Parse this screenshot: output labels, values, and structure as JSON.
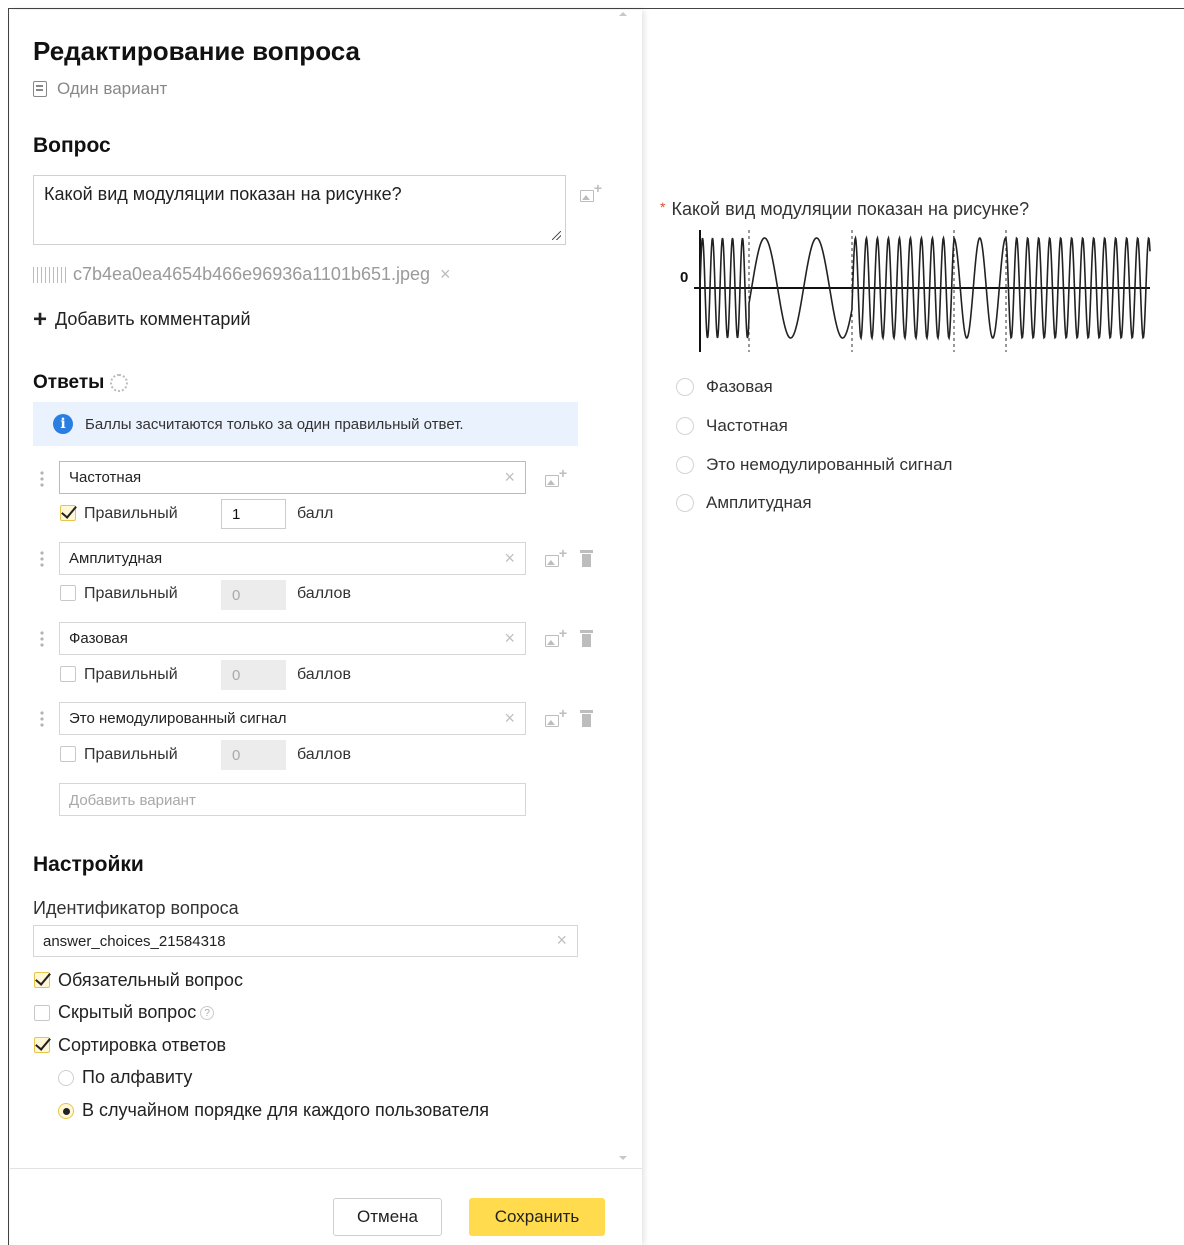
{
  "editor": {
    "title": "Редактирование вопроса",
    "question_type": "Один вариант",
    "question_section": "Вопрос",
    "question_text": "Какой вид модуляции показан на рисунке?",
    "attachment_filename": "c7b4ea0ea4654b466e96936a1101b651.jpeg",
    "add_comment_label": "Добавить комментарий",
    "answers_section": "Ответы",
    "info_text": "Баллы засчитаются только за один правильный ответ.",
    "answers": [
      {
        "text": "Частотная",
        "correct": true,
        "correct_label": "Правильный",
        "score": "1",
        "score_unit": "балл"
      },
      {
        "text": "Амплитудная",
        "correct": false,
        "correct_label": "Правильный",
        "score": "0",
        "score_unit": "баллов"
      },
      {
        "text": "Фазовая",
        "correct": false,
        "correct_label": "Правильный",
        "score": "0",
        "score_unit": "баллов"
      },
      {
        "text": "Это немодулированный сигнал",
        "correct": false,
        "correct_label": "Правильный",
        "score": "0",
        "score_unit": "баллов"
      }
    ],
    "add_variant_placeholder": "Добавить вариант",
    "settings_section": "Настройки",
    "id_label": "Идентификатор вопроса",
    "id_value": "answer_choices_21584318",
    "required_label": "Обязательный вопрос",
    "required_checked": true,
    "hidden_label": "Скрытый вопрос",
    "hidden_checked": false,
    "hidden_help": "?",
    "sort_label": "Сортировка ответов",
    "sort_checked": true,
    "sort_alpha_label": "По алфавиту",
    "sort_random_label": "В случайном порядке для каждого пользователя",
    "sort_selected": "random",
    "cancel_label": "Отмена",
    "save_label": "Сохранить"
  },
  "preview": {
    "required_mark": "*",
    "question_text": "Какой вид модуляции показан на рисунке?",
    "graph_zero_label": "0",
    "options": [
      "Фазовая",
      "Частотная",
      "Это немодулированный сигнал",
      "Амплитудная"
    ]
  },
  "colors": {
    "accent_yellow": "#ffdb4d",
    "info_blue": "#2a7de1",
    "info_bg": "#eaf2fd",
    "required_red": "#e34a2f"
  }
}
